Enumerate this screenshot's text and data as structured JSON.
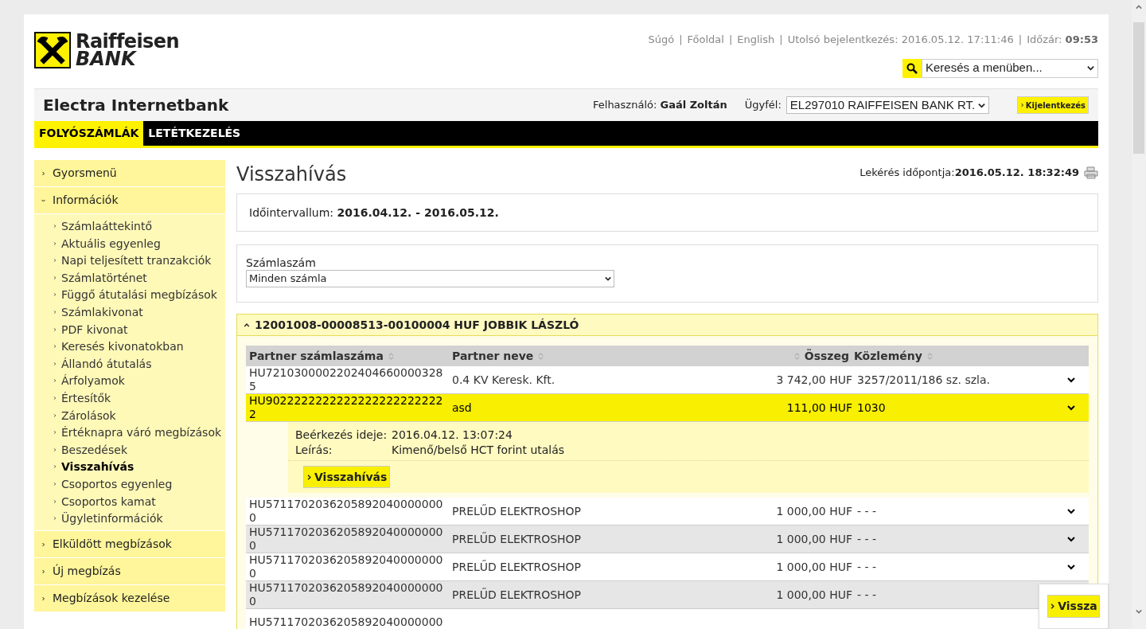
{
  "logo": {
    "line1": "Raiffeisen",
    "line2": "BANK"
  },
  "top_links": [
    {
      "label": "Súgó"
    },
    {
      "label": "Főoldal"
    },
    {
      "label": "English"
    }
  ],
  "separator": "|",
  "last_login": {
    "label": "Utolsó bejelentkezés:",
    "value": "2016.05.12. 17:11:46"
  },
  "timeout": {
    "label": "Időzár:",
    "value": "09:53"
  },
  "menu_search": {
    "value": "Keresés a menüben..."
  },
  "app_title": "Electra Internetbank",
  "user": {
    "label": "Felhasználó:",
    "name": "Gaál Zoltán"
  },
  "client": {
    "label": "Ügyfél:",
    "value": "EL297010 RAIFFEISEN BANK RT."
  },
  "logout": "Kijelentkezés",
  "nav_tabs": [
    {
      "label": "FOLYÓSZÁMLÁK",
      "selected": true
    },
    {
      "label": "LETÉTKEZELÉS",
      "selected": false
    }
  ],
  "sidebar": [
    {
      "label": "Gyorsmenü",
      "expanded": false
    },
    {
      "label": "Információk",
      "expanded": true,
      "children": [
        {
          "label": "Számlaáttekintő",
          "selected": false
        },
        {
          "label": "Aktuális egyenleg",
          "selected": false
        },
        {
          "label": "Napi teljesített tranzakciók",
          "selected": false
        },
        {
          "label": "Számlatörténet",
          "selected": false
        },
        {
          "label": "Függő átutalási megbízások",
          "selected": false
        },
        {
          "label": "Számlakivonat",
          "selected": false
        },
        {
          "label": "PDF kivonat",
          "selected": false
        },
        {
          "label": "Keresés kivonatokban",
          "selected": false
        },
        {
          "label": "Állandó átutalás",
          "selected": false
        },
        {
          "label": "Árfolyamok",
          "selected": false
        },
        {
          "label": "Értesítők",
          "selected": false
        },
        {
          "label": "Zárolások",
          "selected": false
        },
        {
          "label": "Értéknapra váró megbízások",
          "selected": false
        },
        {
          "label": "Beszedések",
          "selected": false
        },
        {
          "label": "Visszahívás",
          "selected": true
        },
        {
          "label": "Csoportos egyenleg",
          "selected": false
        },
        {
          "label": "Csoportos kamat",
          "selected": false
        },
        {
          "label": "Ügyletinformációk",
          "selected": false
        }
      ]
    },
    {
      "label": "Elküldött megbízások",
      "expanded": false
    },
    {
      "label": "Új megbízás",
      "expanded": false
    },
    {
      "label": "Megbízások kezelése",
      "expanded": false
    }
  ],
  "page_title": "Visszahívás",
  "query_time": {
    "label": "Lekérés időpontja:",
    "value": "2016.05.12. 18:32:49"
  },
  "interval": {
    "label": "Időintervallum:",
    "value": "2016.04.12. - 2016.05.12."
  },
  "account_filter": {
    "label": "Számlaszám",
    "value": "Minden számla"
  },
  "account_group": {
    "title": "12001008-00008513-00100004 HUF JOBBIK LÁSZLÓ",
    "expanded": true
  },
  "table": {
    "columns": [
      "Partner számlaszáma",
      "Partner neve",
      "Összeg",
      "Közlemény"
    ],
    "rows": [
      {
        "account": "HU72103000022024046600003285",
        "name": "0.4 KV Keresk. Kft.",
        "amount": "3 742,00 HUF",
        "note": "3257/2011/186 sz. szla.",
        "selected": false,
        "expanded": false
      },
      {
        "account": "HU90222222222222222222222222",
        "name": "asd",
        "amount": "111,00 HUF",
        "note": "1030",
        "selected": true,
        "expanded": true,
        "details": [
          {
            "label": "Beérkezés ideje:",
            "value": "2016.04.12. 13:07:24"
          },
          {
            "label": "Leírás:",
            "value": "Kimenő/belső HCT forint utalás"
          }
        ],
        "action": "Visszahívás"
      },
      {
        "account": "HU57117020362058920400000000",
        "name": "PRELŰD ELEKTROSHOP",
        "amount": "1 000,00 HUF",
        "note": "- - -",
        "selected": false,
        "expanded": false
      },
      {
        "account": "HU57117020362058920400000000",
        "name": "PRELŰD ELEKTROSHOP",
        "amount": "1 000,00 HUF",
        "note": "- - -",
        "selected": false,
        "expanded": false
      },
      {
        "account": "HU57117020362058920400000000",
        "name": "PRELŰD ELEKTROSHOP",
        "amount": "1 000,00 HUF",
        "note": "- - -",
        "selected": false,
        "expanded": false
      },
      {
        "account": "HU57117020362058920400000000",
        "name": "PRELŰD ELEKTROSHOP",
        "amount": "1 000,00 HUF",
        "note": "- - -",
        "selected": false,
        "expanded": false,
        "toggle": false
      },
      {
        "account": "HU5711702036205892040000000",
        "selected": false,
        "expanded": false,
        "toggle": false
      }
    ]
  },
  "back_button": "Vissza"
}
